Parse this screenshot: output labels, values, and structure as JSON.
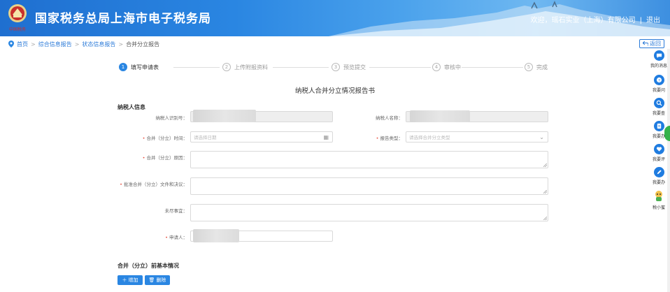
{
  "header": {
    "title": "国家税务总局上海市电子税务局",
    "welcome": "欢迎，瑶石实业（上海）有限公司",
    "separator": "|",
    "logout": "退出",
    "colors": {
      "primary": "#2a86e2",
      "required": "#e74c3c"
    }
  },
  "breadcrumb": {
    "items": [
      "首页",
      "综合信息报告",
      "状态信息报告",
      "合并分立报告"
    ],
    "separator": ">"
  },
  "back_button": "返回",
  "steps": [
    {
      "num": "1",
      "label": "填写申请表",
      "active": true
    },
    {
      "num": "2",
      "label": "上传附报资料",
      "active": false
    },
    {
      "num": "3",
      "label": "预览提交",
      "active": false
    },
    {
      "num": "4",
      "label": "审核中",
      "active": false
    },
    {
      "num": "5",
      "label": "完成",
      "active": false
    }
  ],
  "form": {
    "title": "纳税人合并分立情况报告书",
    "section_taxpayer": "纳税人信息",
    "taxpayer_id_label": "纳税人识别号：",
    "taxpayer_name_label": "纳税人名称：",
    "merge_time_label": "合并（分立）时间：",
    "merge_time_placeholder": "请选择日期",
    "report_type_label": "报告类型：",
    "report_type_placeholder": "请选择合并分立类型",
    "merge_reason_label": "合并（分立）原因：",
    "approval_doc_label": "批准合并（分立）文件和决议：",
    "unsettled_label": "未尽事宜：",
    "applicant_label": "申请人：",
    "section_before": "合并（分立）前基本情况",
    "add_button": "增加",
    "delete_button": "删除"
  },
  "rail": [
    {
      "icon": "message-icon",
      "label": "我的消息"
    },
    {
      "icon": "question-icon",
      "label": "我要问"
    },
    {
      "icon": "search-icon",
      "label": "我要查"
    },
    {
      "icon": "doc-icon",
      "label": "我要办"
    },
    {
      "icon": "heart-icon",
      "label": "我要评"
    },
    {
      "icon": "pen-icon",
      "label": "我要办"
    },
    {
      "icon": "robot-icon",
      "label": "税小蜜"
    }
  ]
}
